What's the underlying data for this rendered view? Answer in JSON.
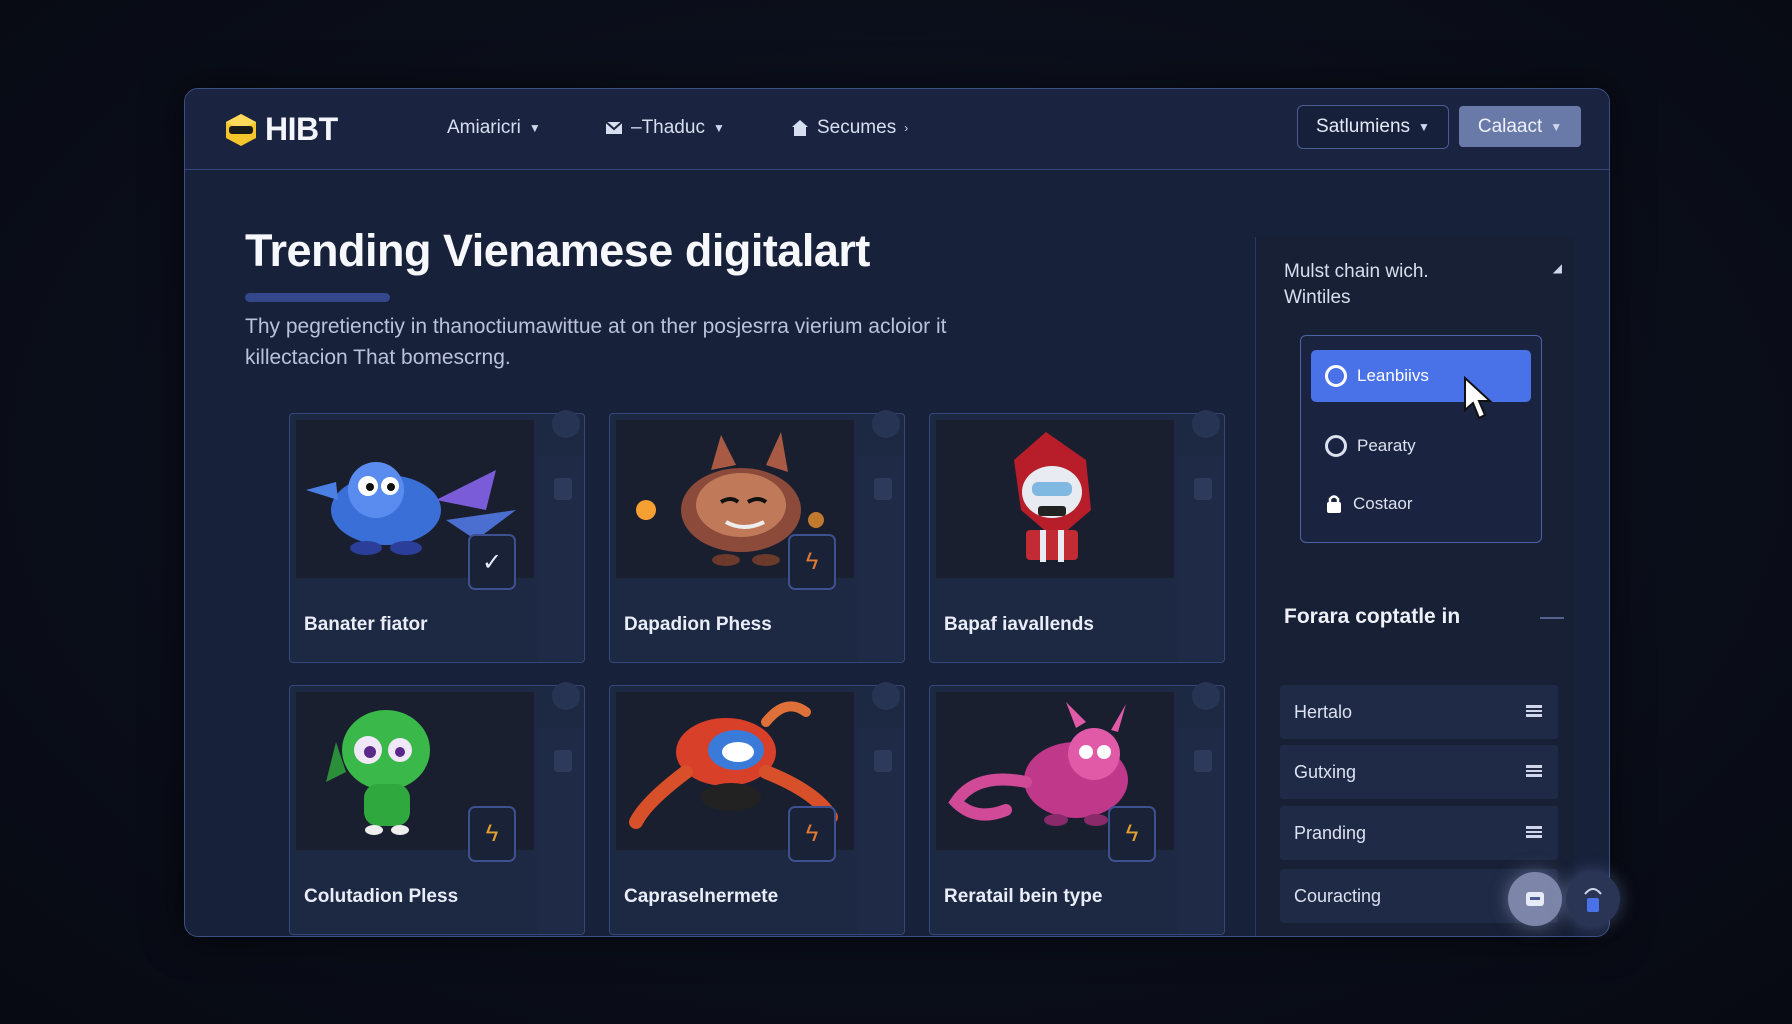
{
  "header": {
    "logo_text": "HIBT",
    "nav": [
      {
        "label": "Amiaricri",
        "icon": "chevron-down-icon"
      },
      {
        "label": "–Thaduc",
        "icon": "mail-icon"
      },
      {
        "label": "Secumes",
        "icon": "home-icon"
      }
    ],
    "outline_button": "Satlumiens",
    "solid_button": "Calaact"
  },
  "main": {
    "title": "Trending Vienamese digitalart",
    "description_line1": "Thy pegretienctiy in thanoctiumawittue at on ther posjesrra vierium acloior it",
    "description_line2": "killectacion That bomescrng.",
    "cards": [
      {
        "title": "Banater fiator",
        "art": "blue-dragon-icon"
      },
      {
        "title": "Dapadion Phess",
        "art": "brown-cat-icon"
      },
      {
        "title": "Bapaf iavallends",
        "art": "red-robot-icon"
      },
      {
        "title": "Colutadion Pless",
        "art": "green-creature-icon"
      },
      {
        "title": "Capraselnermete",
        "art": "red-octopus-icon"
      },
      {
        "title": "Reratail bein type",
        "art": "pink-dragon-icon"
      }
    ]
  },
  "sidebar": {
    "heading_line1": "Mulst chain wich.",
    "heading_line2": "Wintiles",
    "menu": [
      {
        "label": "Leanbiivs",
        "active": true
      },
      {
        "label": "Pearaty",
        "active": false
      },
      {
        "label": "Costaor",
        "active": false
      }
    ],
    "section_title": "Forara coptatle in",
    "filters": [
      "Hertalo",
      "Gutxing",
      "Pranding",
      "Couracting"
    ]
  },
  "colors": {
    "accent": "#4a72e8",
    "background": "#18213a",
    "logo_yellow": "#f5c52b"
  }
}
